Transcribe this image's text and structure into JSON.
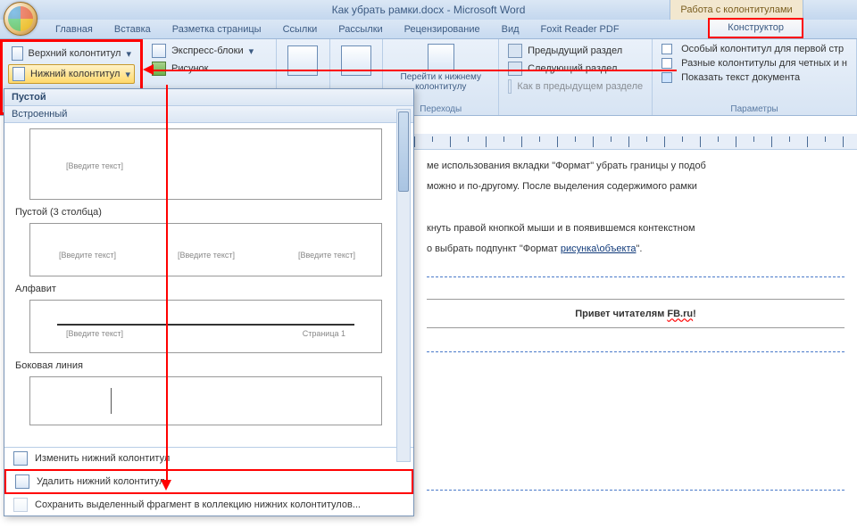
{
  "title": "Как убрать рамки.docx - Microsoft Word",
  "context_title": "Работа с колонтитулами",
  "tabs": [
    "Главная",
    "Вставка",
    "Разметка страницы",
    "Ссылки",
    "Рассылки",
    "Рецензирование",
    "Вид",
    "Foxit Reader PDF"
  ],
  "context_tab": "Конструктор",
  "ribbon": {
    "header_btn": "Верхний колонтитул",
    "footer_btn": "Нижний колонтитул",
    "express": "Экспресс-блоки",
    "picture": "Рисунок",
    "goto_footer": "Перейти к нижнему колонтитулу",
    "prev_section": "Предыдущий раздел",
    "next_section": "Следующий раздел",
    "as_prev": "Как в предыдущем разделе",
    "transitions_label": "Переходы",
    "special_first": "Особый колонтитул для первой стр",
    "diff_oddeven": "Разные колонтитулы для четных и н",
    "show_text": "Показать текст документа",
    "params_label": "Параметры"
  },
  "dropdown": {
    "head_empty": "Пустой",
    "head_builtin": "Встроенный",
    "ph": "[Введите текст]",
    "empty3": "Пустой (3 столбца)",
    "alphabet": "Алфавит",
    "page_label": "Страница 1",
    "sideline": "Боковая линия",
    "edit": "Изменить нижний колонтитул",
    "remove": "Удалить нижний колонтитул",
    "save": "Сохранить выделенный фрагмент в коллекцию нижних колонтитулов..."
  },
  "doc": {
    "p1": "ме использования вкладки \"Формат\" убрать границы у подоб",
    "p2": "можно и по-другому. После выделения содержимого рамки",
    "p3a": "кнуть правой кнопкой мыши и в появившемся контекстном",
    "p3b_pre": "о выбрать подпункт \"Формат ",
    "p3b_link": "рисунка\\объекта",
    "p3b_post": "\".",
    "header_text_a": "Привет читателям ",
    "header_text_b": "FB.ru",
    "header_text_c": "!"
  }
}
